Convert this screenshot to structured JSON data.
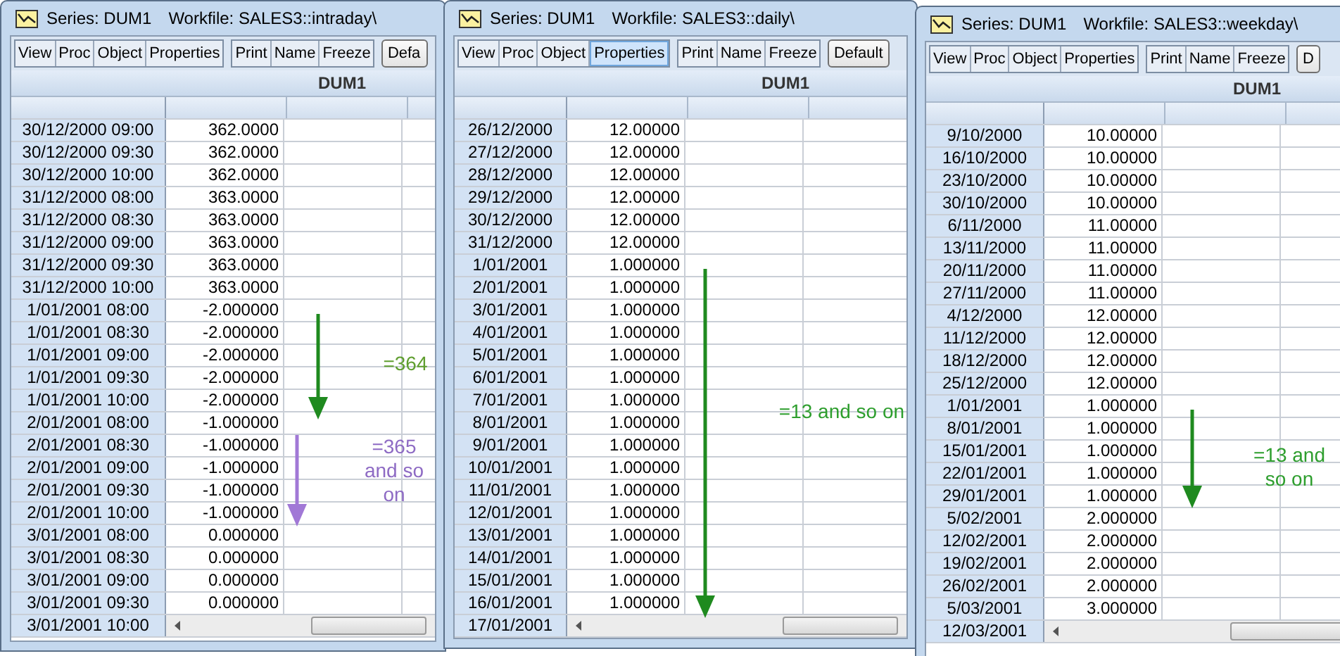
{
  "windows": [
    {
      "title": "Series: DUM1",
      "workfile": "Workfile: SALES3::intraday\\",
      "toolbar": [
        {
          "label": "View",
          "highlighted": false
        },
        {
          "label": "Proc",
          "highlighted": false
        },
        {
          "label": "Object",
          "highlighted": false
        },
        {
          "label": "Properties",
          "highlighted": false
        }
      ],
      "toolbar2": [
        {
          "label": "Print",
          "highlighted": false
        },
        {
          "label": "Name",
          "highlighted": false
        },
        {
          "label": "Freeze",
          "highlighted": false
        }
      ],
      "default_button": "Defa",
      "column_header": "DUM1",
      "rows": [
        {
          "date": "30/12/2000 09:00",
          "value": "362.0000"
        },
        {
          "date": "30/12/2000 09:30",
          "value": "362.0000"
        },
        {
          "date": "30/12/2000 10:00",
          "value": "362.0000"
        },
        {
          "date": "31/12/2000 08:00",
          "value": "363.0000"
        },
        {
          "date": "31/12/2000 08:30",
          "value": "363.0000"
        },
        {
          "date": "31/12/2000 09:00",
          "value": "363.0000"
        },
        {
          "date": "31/12/2000 09:30",
          "value": "363.0000"
        },
        {
          "date": "31/12/2000 10:00",
          "value": "363.0000"
        },
        {
          "date": "1/01/2001 08:00",
          "value": "-2.000000"
        },
        {
          "date": "1/01/2001 08:30",
          "value": "-2.000000"
        },
        {
          "date": "1/01/2001 09:00",
          "value": "-2.000000"
        },
        {
          "date": "1/01/2001 09:30",
          "value": "-2.000000"
        },
        {
          "date": "1/01/2001 10:00",
          "value": "-2.000000"
        },
        {
          "date": "2/01/2001 08:00",
          "value": "-1.000000"
        },
        {
          "date": "2/01/2001 08:30",
          "value": "-1.000000"
        },
        {
          "date": "2/01/2001 09:00",
          "value": "-1.000000"
        },
        {
          "date": "2/01/2001 09:30",
          "value": "-1.000000"
        },
        {
          "date": "2/01/2001 10:00",
          "value": "-1.000000"
        },
        {
          "date": "3/01/2001 08:00",
          "value": "0.000000"
        },
        {
          "date": "3/01/2001 08:30",
          "value": "0.000000"
        },
        {
          "date": "3/01/2001 09:00",
          "value": "0.000000"
        },
        {
          "date": "3/01/2001 09:30",
          "value": "0.000000"
        }
      ],
      "scroll_row": "3/01/2001 10:00",
      "annotations": [
        {
          "kind": "arrow",
          "color": "#1f8a1f"
        },
        {
          "kind": "arrow",
          "color": "#a178d6"
        },
        {
          "kind": "note",
          "text": "=364",
          "color": "#5f9e2f"
        },
        {
          "kind": "note",
          "text": "=365 and so on",
          "color": "#8e6bc4"
        }
      ]
    },
    {
      "title": "Series: DUM1",
      "workfile": "Workfile: SALES3::daily\\",
      "toolbar": [
        {
          "label": "View",
          "highlighted": false
        },
        {
          "label": "Proc",
          "highlighted": false
        },
        {
          "label": "Object",
          "highlighted": false
        },
        {
          "label": "Properties",
          "highlighted": true
        }
      ],
      "toolbar2": [
        {
          "label": "Print",
          "highlighted": false
        },
        {
          "label": "Name",
          "highlighted": false
        },
        {
          "label": "Freeze",
          "highlighted": false
        }
      ],
      "default_button": "Default",
      "column_header": "DUM1",
      "rows": [
        {
          "date": "26/12/2000",
          "value": "12.00000"
        },
        {
          "date": "27/12/2000",
          "value": "12.00000"
        },
        {
          "date": "28/12/2000",
          "value": "12.00000"
        },
        {
          "date": "29/12/2000",
          "value": "12.00000"
        },
        {
          "date": "30/12/2000",
          "value": "12.00000"
        },
        {
          "date": "31/12/2000",
          "value": "12.00000"
        },
        {
          "date": "1/01/2001",
          "value": "1.000000"
        },
        {
          "date": "2/01/2001",
          "value": "1.000000"
        },
        {
          "date": "3/01/2001",
          "value": "1.000000"
        },
        {
          "date": "4/01/2001",
          "value": "1.000000"
        },
        {
          "date": "5/01/2001",
          "value": "1.000000"
        },
        {
          "date": "6/01/2001",
          "value": "1.000000"
        },
        {
          "date": "7/01/2001",
          "value": "1.000000"
        },
        {
          "date": "8/01/2001",
          "value": "1.000000"
        },
        {
          "date": "9/01/2001",
          "value": "1.000000"
        },
        {
          "date": "10/01/2001",
          "value": "1.000000"
        },
        {
          "date": "11/01/2001",
          "value": "1.000000"
        },
        {
          "date": "12/01/2001",
          "value": "1.000000"
        },
        {
          "date": "13/01/2001",
          "value": "1.000000"
        },
        {
          "date": "14/01/2001",
          "value": "1.000000"
        },
        {
          "date": "15/01/2001",
          "value": "1.000000"
        },
        {
          "date": "16/01/2001",
          "value": "1.000000"
        }
      ],
      "scroll_row": "17/01/2001",
      "annotations": [
        {
          "kind": "arrow",
          "color": "#1f8a1f"
        },
        {
          "kind": "note",
          "text": "=13 and so on",
          "color": "#2e9e2e"
        }
      ]
    },
    {
      "title": "Series: DUM1",
      "workfile": "Workfile: SALES3::weekday\\",
      "toolbar": [
        {
          "label": "View",
          "highlighted": false
        },
        {
          "label": "Proc",
          "highlighted": false
        },
        {
          "label": "Object",
          "highlighted": false
        },
        {
          "label": "Properties",
          "highlighted": false
        }
      ],
      "toolbar2": [
        {
          "label": "Print",
          "highlighted": false
        },
        {
          "label": "Name",
          "highlighted": false
        },
        {
          "label": "Freeze",
          "highlighted": false
        }
      ],
      "default_button": "D",
      "column_header": "DUM1",
      "rows": [
        {
          "date": "9/10/2000",
          "value": "10.00000"
        },
        {
          "date": "16/10/2000",
          "value": "10.00000"
        },
        {
          "date": "23/10/2000",
          "value": "10.00000"
        },
        {
          "date": "30/10/2000",
          "value": "10.00000"
        },
        {
          "date": "6/11/2000",
          "value": "11.00000"
        },
        {
          "date": "13/11/2000",
          "value": "11.00000"
        },
        {
          "date": "20/11/2000",
          "value": "11.00000"
        },
        {
          "date": "27/11/2000",
          "value": "11.00000"
        },
        {
          "date": "4/12/2000",
          "value": "12.00000"
        },
        {
          "date": "11/12/2000",
          "value": "12.00000"
        },
        {
          "date": "18/12/2000",
          "value": "12.00000"
        },
        {
          "date": "25/12/2000",
          "value": "12.00000"
        },
        {
          "date": "1/01/2001",
          "value": "1.000000"
        },
        {
          "date": "8/01/2001",
          "value": "1.000000"
        },
        {
          "date": "15/01/2001",
          "value": "1.000000"
        },
        {
          "date": "22/01/2001",
          "value": "1.000000"
        },
        {
          "date": "29/01/2001",
          "value": "1.000000"
        },
        {
          "date": "5/02/2001",
          "value": "2.000000"
        },
        {
          "date": "12/02/2001",
          "value": "2.000000"
        },
        {
          "date": "19/02/2001",
          "value": "2.000000"
        },
        {
          "date": "26/02/2001",
          "value": "2.000000"
        },
        {
          "date": "5/03/2001",
          "value": "3.000000"
        }
      ],
      "scroll_row": "12/03/2001",
      "annotations": [
        {
          "kind": "arrow",
          "color": "#1f8a1f"
        },
        {
          "kind": "note",
          "text": "=13 and so on",
          "color": "#2e9e2e"
        }
      ]
    }
  ]
}
